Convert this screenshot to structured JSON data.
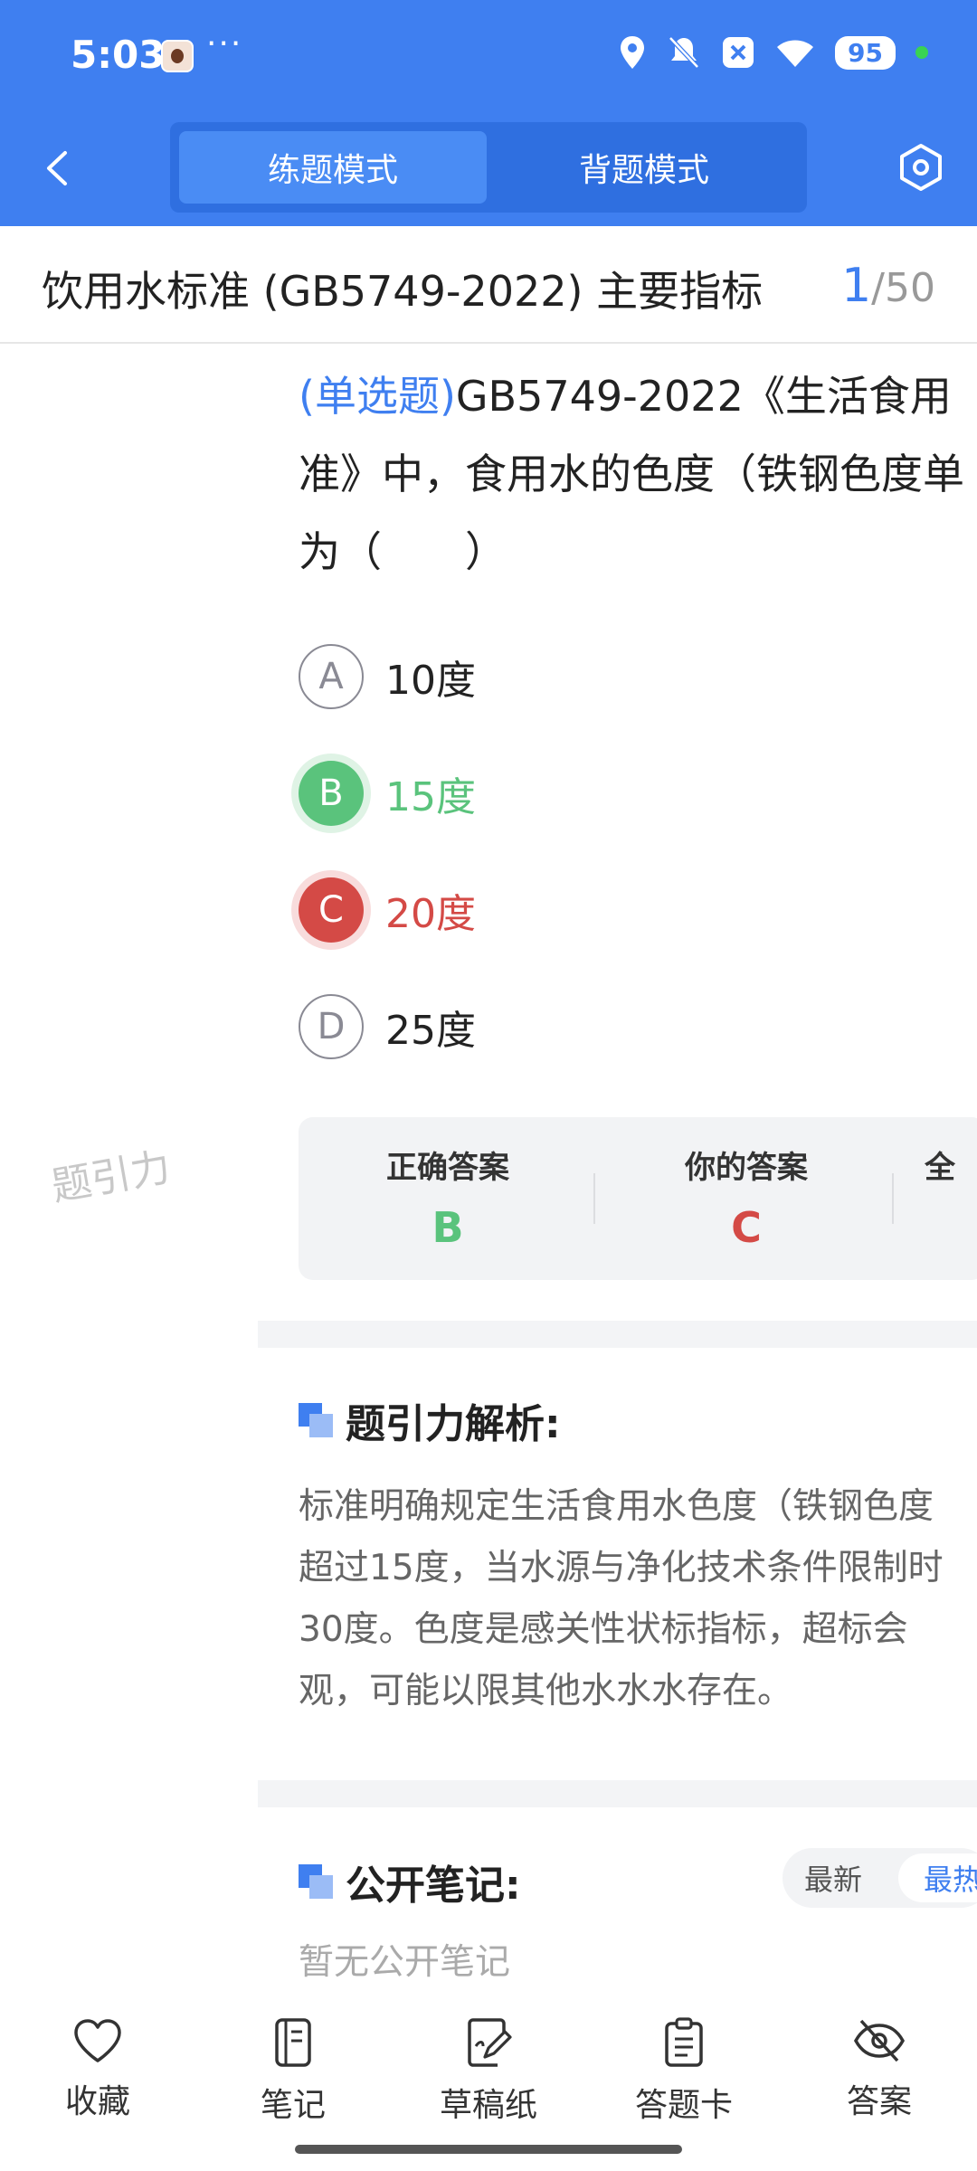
{
  "status_bar": {
    "time": "5:03",
    "more": "···",
    "battery": "95",
    "icons": [
      "avatar-icon",
      "location-icon",
      "bell-muted-icon",
      "close-box-icon",
      "wifi-icon",
      "battery-icon",
      "active-dot"
    ]
  },
  "app_bar": {
    "tabs": [
      {
        "label": "练题模式",
        "active": true
      },
      {
        "label": "背题模式",
        "active": false
      }
    ],
    "back_icon": "chevron-left-icon",
    "settings_icon": "hexagon-settings-icon"
  },
  "header": {
    "title": "饮用水标准 (GB5749-2022) 主要指标",
    "current": "1",
    "separator": "/",
    "total": "50"
  },
  "watermark": "题引力",
  "question": {
    "type": "(单选题)",
    "line1": "GB5749-2022《生活食用",
    "line2": "准》中，食用水的色度（铁钢色度单",
    "line3": "为（　　）"
  },
  "options": [
    {
      "letter": "A",
      "text": "10度",
      "state": "normal"
    },
    {
      "letter": "B",
      "text": "15度",
      "state": "correct"
    },
    {
      "letter": "C",
      "text": "20度",
      "state": "wrong"
    },
    {
      "letter": "D",
      "text": "25度",
      "state": "normal"
    }
  ],
  "answer_summary": {
    "correct_label": "正确答案",
    "correct_value": "B",
    "yours_label": "你的答案",
    "yours_value": "C",
    "third_label": "全"
  },
  "analysis": {
    "title": "题引力解析:",
    "lines": [
      "标准明确规定生活食用水色度（铁钢色度",
      "超过15度，当水源与净化技术条件限制时",
      "30度。色度是感关性状标指标，超标会",
      "观，可能以限其他水水水存在。"
    ]
  },
  "notes": {
    "title": "公开笔记:",
    "sort_new": "最新",
    "sort_hot": "最热",
    "empty": "暂无公开笔记"
  },
  "bottom_nav": [
    {
      "label": "收藏",
      "icon": "heart-icon"
    },
    {
      "label": "笔记",
      "icon": "notebook-icon"
    },
    {
      "label": "草稿纸",
      "icon": "draft-paper-icon"
    },
    {
      "label": "答题卡",
      "icon": "answer-card-icon"
    },
    {
      "label": "答案",
      "icon": "eye-off-icon"
    }
  ],
  "colors": {
    "primary": "#3f7ff0",
    "correct": "#5ac37c",
    "wrong": "#d44a46"
  }
}
